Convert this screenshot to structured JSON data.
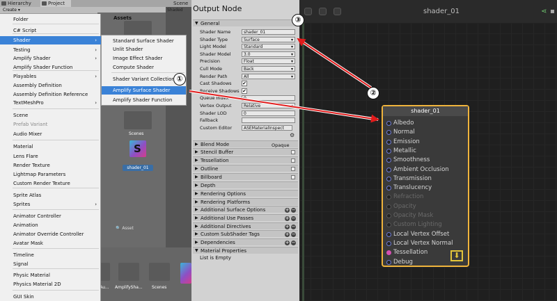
{
  "tabs": {
    "hierarchy": "Hierarchy",
    "project": "Project",
    "scene": "Scene",
    "shaded": "Shaded"
  },
  "create_button": "Create",
  "assets_title": "Assets",
  "scenes_folder": "Scenes",
  "shader_asset": "shader_01",
  "asset_path": "Asset",
  "bottom_items": [
    "Au...",
    "AmplifySha...",
    "Scenes"
  ],
  "main_menu": {
    "items": [
      {
        "label": "Folder",
        "disabled": false,
        "arrow": false
      },
      {
        "label": "C# Script",
        "disabled": false,
        "arrow": false
      },
      {
        "label": "Shader",
        "disabled": false,
        "arrow": true,
        "highlighted": true
      },
      {
        "label": "Testing",
        "disabled": false,
        "arrow": true
      },
      {
        "label": "Amplify Shader",
        "disabled": false,
        "arrow": true
      },
      {
        "label": "Amplify Shader Function",
        "disabled": false,
        "arrow": false
      },
      {
        "label": "Playables",
        "disabled": false,
        "arrow": true
      },
      {
        "label": "Assembly Definition",
        "disabled": false,
        "arrow": false
      },
      {
        "label": "Assembly Definition Reference",
        "disabled": false,
        "arrow": false
      },
      {
        "label": "TextMeshPro",
        "disabled": false,
        "arrow": true
      },
      {
        "label": "Scene",
        "disabled": false,
        "arrow": false
      },
      {
        "label": "Prefab Variant",
        "disabled": true,
        "arrow": false
      },
      {
        "label": "Audio Mixer",
        "disabled": false,
        "arrow": false
      },
      {
        "label": "Material",
        "disabled": false,
        "arrow": false
      },
      {
        "label": "Lens Flare",
        "disabled": false,
        "arrow": false
      },
      {
        "label": "Render Texture",
        "disabled": false,
        "arrow": false
      },
      {
        "label": "Lightmap Parameters",
        "disabled": false,
        "arrow": false
      },
      {
        "label": "Custom Render Texture",
        "disabled": false,
        "arrow": false
      },
      {
        "label": "Sprite Atlas",
        "disabled": false,
        "arrow": false
      },
      {
        "label": "Sprites",
        "disabled": false,
        "arrow": true
      },
      {
        "label": "Animator Controller",
        "disabled": false,
        "arrow": false
      },
      {
        "label": "Animation",
        "disabled": false,
        "arrow": false
      },
      {
        "label": "Animator Override Controller",
        "disabled": false,
        "arrow": false
      },
      {
        "label": "Avatar Mask",
        "disabled": false,
        "arrow": false
      },
      {
        "label": "Timeline",
        "disabled": false,
        "arrow": false
      },
      {
        "label": "Signal",
        "disabled": false,
        "arrow": false
      },
      {
        "label": "Physic Material",
        "disabled": false,
        "arrow": false
      },
      {
        "label": "Physics Material 2D",
        "disabled": false,
        "arrow": false
      },
      {
        "label": "GUI Skin",
        "disabled": false,
        "arrow": false
      }
    ]
  },
  "sub_menu": {
    "items": [
      {
        "label": "Standard Surface Shader"
      },
      {
        "label": "Unlit Shader"
      },
      {
        "label": "Image Effect Shader"
      },
      {
        "label": "Compute Shader"
      },
      {
        "label": "Shader Variant Collection"
      },
      {
        "label": "Amplify Surface Shader",
        "highlighted": true
      },
      {
        "label": "Amplify Shader Function"
      }
    ]
  },
  "output_node": {
    "title": "Output Node",
    "general_section": "General",
    "props": [
      {
        "label": "Shader Name",
        "value": "shader_01",
        "type": "text"
      },
      {
        "label": "Shader Type",
        "value": "Surface",
        "type": "dropdown"
      },
      {
        "label": "Light Model",
        "value": "Standard",
        "type": "dropdown"
      },
      {
        "label": "Shader Model",
        "value": "3.0",
        "type": "dropdown"
      },
      {
        "label": "Precision",
        "value": "Float",
        "type": "dropdown"
      },
      {
        "label": "Cull Mode",
        "value": "Back",
        "type": "dropdown"
      },
      {
        "label": "Render Path",
        "value": "All",
        "type": "dropdown"
      },
      {
        "label": "Cast Shadows",
        "value": "✔",
        "type": "check"
      },
      {
        "label": "Receive Shadows",
        "value": "✔",
        "type": "check"
      },
      {
        "label": "Queue Index",
        "value": "0",
        "type": "text"
      },
      {
        "label": "Vertex Output",
        "value": "Relative",
        "type": "dropdown"
      },
      {
        "label": "Shader LOD",
        "value": "0",
        "type": "text"
      },
      {
        "label": "Fallback",
        "value": "",
        "type": "text"
      },
      {
        "label": "Custom Editor",
        "value": "ASEMaterialInspect",
        "type": "text"
      }
    ],
    "sections": [
      {
        "label": "Blend Mode",
        "extra": "Opaque"
      },
      {
        "label": "Stencil Buffer",
        "toggle": true
      },
      {
        "label": "Tessellation",
        "toggle": true
      },
      {
        "label": "Outline",
        "toggle": true
      },
      {
        "label": "Billboard",
        "toggle": true
      },
      {
        "label": "Depth"
      },
      {
        "label": "Rendering Options"
      },
      {
        "label": "Rendering Platforms"
      },
      {
        "label": "Additional Surface Options",
        "plusminus": true
      },
      {
        "label": "Additional Use Passes",
        "plusminus": true
      },
      {
        "label": "Additional Directives",
        "plusminus": true
      },
      {
        "label": "Custom SubShader Tags",
        "plusminus": true
      },
      {
        "label": "Dependencies",
        "plusminus": true
      },
      {
        "label": "Material Properties"
      }
    ],
    "list_empty": "List is Empty"
  },
  "canvas": {
    "title": "shader_01",
    "node": {
      "title": "shader_01",
      "ports": [
        {
          "label": "Albedo",
          "enabled": true
        },
        {
          "label": "Normal",
          "enabled": true
        },
        {
          "label": "Emission",
          "enabled": true
        },
        {
          "label": "Metallic",
          "enabled": true
        },
        {
          "label": "Smoothness",
          "enabled": true
        },
        {
          "label": "Ambient Occlusion",
          "enabled": true
        },
        {
          "label": "Transmission",
          "enabled": true
        },
        {
          "label": "Translucency",
          "enabled": true
        },
        {
          "label": "Refraction",
          "enabled": false
        },
        {
          "label": "Opacity",
          "enabled": false
        },
        {
          "label": "Opacity Mask",
          "enabled": false
        },
        {
          "label": "Custom Lighting",
          "enabled": false
        },
        {
          "label": "Local Vertex Offset",
          "enabled": true
        },
        {
          "label": "Local Vertex Normal",
          "enabled": true
        },
        {
          "label": "Tessellation",
          "enabled": true,
          "pink": true
        },
        {
          "label": "Debug",
          "enabled": true
        }
      ]
    }
  },
  "callouts": [
    "①",
    "②",
    "③"
  ],
  "colors": {
    "accent": "#3a82d7",
    "node_border": "#f0b43c",
    "arrow": "#e01b1b"
  }
}
